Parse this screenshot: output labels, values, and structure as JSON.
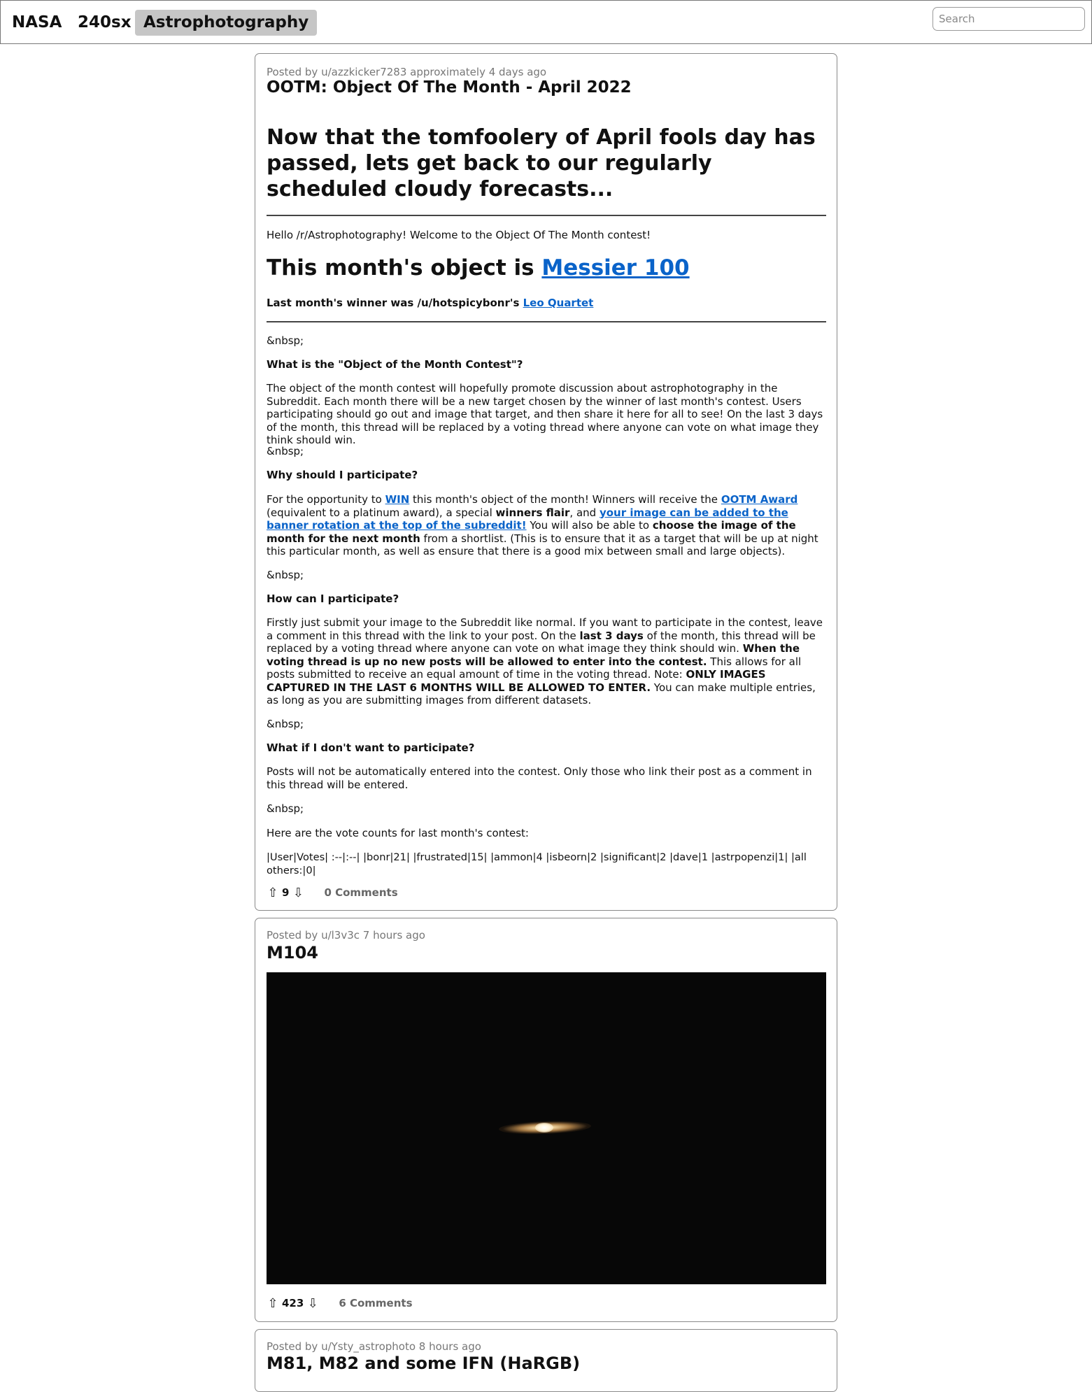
{
  "nav": {
    "tabs": [
      {
        "label": "NASA"
      },
      {
        "label": "240sx"
      },
      {
        "label": "Astrophotography"
      }
    ],
    "search_placeholder": "Search"
  },
  "posts": [
    {
      "meta": "Posted by u/azzkicker7283 approximately 4 days ago",
      "title": "OOTM: Object Of The Month - April 2022",
      "heading": "Now that the tomfoolery of April fools day has passed, lets get back to our regularly scheduled cloudy forecasts...",
      "welcome": "Hello /r/Astrophotography! Welcome to the Object Of The Month contest!",
      "object_prefix": "This month's object is ",
      "object_link": "Messier 100",
      "winner_prefix": "Last month's winner was /u/hotspicybonr's ",
      "winner_link": "Leo Quartet",
      "nbsp": "&nbsp;",
      "q1": "What is the \"Object of the Month Contest\"?",
      "a1": "The object of the month contest will hopefully promote discussion about astrophotography in the Subreddit. Each month there will be a new target chosen by the winner of last month's contest. Users participating should go out and image that target, and then share it here for all to see! On the last 3 days of the month, this thread will be replaced by a voting thread where anyone can vote on what image they think should win.",
      "q2": "Why should I participate?",
      "a2": {
        "t1": "For the opportunity to ",
        "l1": "WIN",
        "t2": " this month's object of the month! Winners will receive the ",
        "l2": "OOTM Award",
        "t3": " (equivalent to a platinum award), a special ",
        "b1": "winners flair",
        "t4": ", and ",
        "l3": "your image can be added to the banner rotation at the top of the subreddit!",
        "t5": " You will also be able to ",
        "b2": "choose the image of the month for the next month",
        "t6": " from a shortlist. (This is to ensure that it as a target that will be up at night this particular month, as well as ensure that there is a good mix between small and large objects)."
      },
      "q3": "How can I participate?",
      "a3": {
        "t1": "Firstly just submit your image to the Subreddit like normal. If you want to participate in the contest, leave a comment in this thread with the link to your post. On the ",
        "b1": "last 3 days",
        "t2": " of the month, this thread will be replaced by a voting thread where anyone can vote on what image they think should win. ",
        "b2": "When the voting thread is up no new posts will be allowed to enter into the contest.",
        "t3": " This allows for all posts submitted to receive an equal amount of time in the voting thread. Note: ",
        "b3": "ONLY IMAGES CAPTURED IN THE LAST 6 MONTHS WILL BE ALLOWED TO ENTER.",
        "t4": " You can make multiple entries, as long as you are submitting images from different datasets."
      },
      "q4": "What if I don't want to participate?",
      "a4": "Posts will not be automatically entered into the contest. Only those who link their post as a comment in this thread will be entered.",
      "votes_intro": "Here are the vote counts for last month's contest:",
      "votes_table": "|User|Votes| :--|:--| |bonr|21| |frustrated|15| |ammon|4 |isbeorn|2 |significant|2 |dave|1 |astrpopenzi|1| |all others:|0|",
      "score": "9",
      "comments": "0 Comments"
    },
    {
      "meta": "Posted by u/l3v3c 7 hours ago",
      "title": "M104",
      "score": "423",
      "comments": "6 Comments"
    },
    {
      "meta": "Posted by u/Ysty_astrophoto 8 hours ago",
      "title": "M81, M82 and some IFN (HaRGB)"
    }
  ],
  "icons": {
    "upvote": "arrow-up-outline-icon",
    "downvote": "arrow-down-outline-icon"
  },
  "colors": {
    "link": "#0a63c9",
    "active_tab": "#c6c6c6",
    "border": "#8a8a8a"
  }
}
